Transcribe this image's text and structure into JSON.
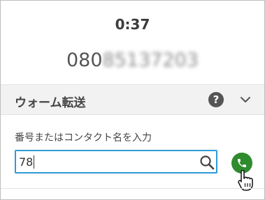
{
  "call": {
    "timer": "0:37",
    "number_visible": "080",
    "number_masked": "85137203"
  },
  "transfer": {
    "title": "ウォーム転送",
    "help_icon": "?",
    "field_label": "番号またはコンタクト名を入力",
    "input_value": "78",
    "input_placeholder": ""
  },
  "icons": {
    "help": "question-circle-icon",
    "collapse": "chevron-down-icon",
    "search": "search-icon",
    "call": "phone-icon",
    "cursor": "hand-pointer-icon"
  },
  "colors": {
    "accent_border": "#2e9bd6",
    "call_green": "#2e8b2e",
    "header_bg": "#f2f2f2"
  }
}
